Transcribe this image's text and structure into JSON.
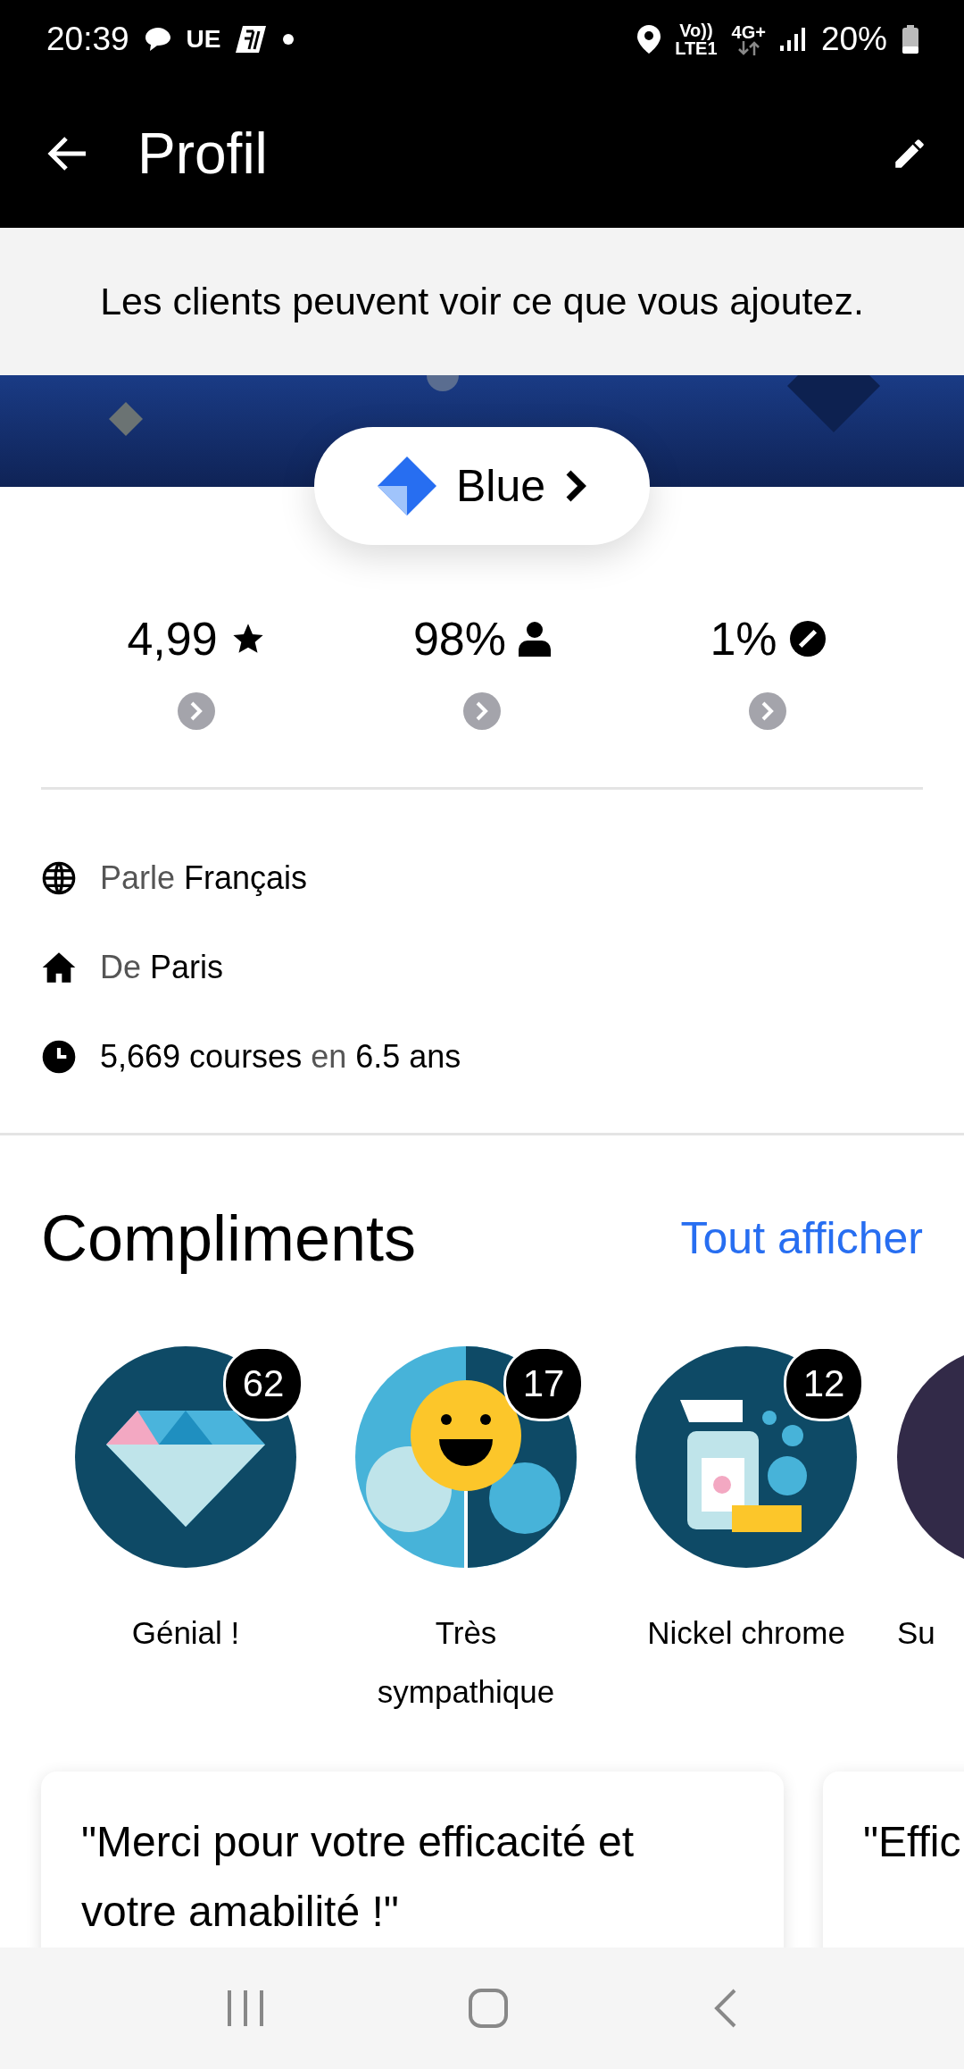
{
  "status_bar": {
    "time": "20:39",
    "notif_text": "UE",
    "volte_top": "Vo))",
    "volte_bottom": "LTE1",
    "network": "4G+",
    "battery": "20%"
  },
  "app_bar": {
    "title": "Profil"
  },
  "notice": "Les clients peuvent voir ce que vous ajoutez.",
  "tier": {
    "label": "Blue"
  },
  "stats": [
    {
      "kind": "rating",
      "value": "4,99"
    },
    {
      "kind": "acceptance",
      "value": "98%"
    },
    {
      "kind": "cancellation",
      "value": "1%"
    }
  ],
  "info": [
    {
      "kind": "language",
      "text": "Parle **Français**"
    },
    {
      "kind": "home",
      "text": "De **Paris**"
    },
    {
      "kind": "trips",
      "text": "**5,669 courses** en **6.5 ans**"
    }
  ],
  "compliments": {
    "title": "Compliments",
    "link": "Tout afficher",
    "items": [
      {
        "kind": "diamond",
        "label": "Génial !",
        "count": "62"
      },
      {
        "kind": "smiley",
        "label": "Très sympathique",
        "count": "17"
      },
      {
        "kind": "spray",
        "label": "Nickel chrome",
        "count": "12"
      },
      {
        "kind": "other",
        "label": "Su"
      }
    ]
  },
  "quotes": [
    "\"Merci pour votre efficacité et votre amabilité !\"",
    "\"Effic"
  ]
}
